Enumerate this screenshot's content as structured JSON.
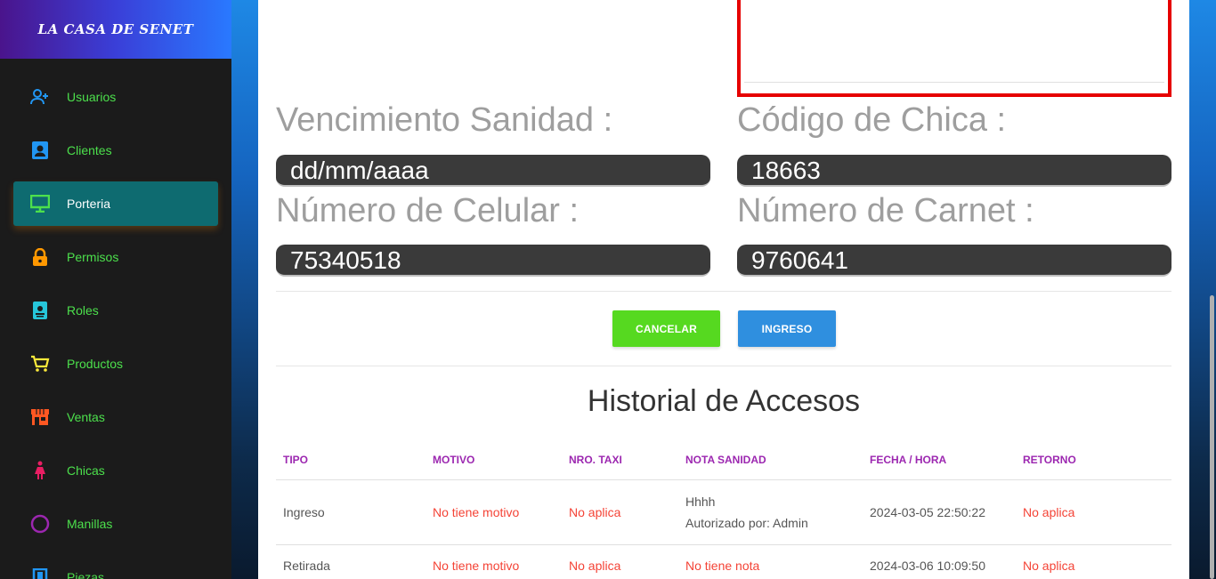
{
  "brand": "LA CASA DE SENET",
  "sidebar": {
    "items": [
      {
        "label": "Usuarios",
        "icon": "user-plus-icon",
        "color": "#2196f3"
      },
      {
        "label": "Clientes",
        "icon": "contact-card-icon",
        "color": "#2196f3"
      },
      {
        "label": "Porteria",
        "icon": "monitor-icon",
        "color": "#4ce04c",
        "active": true
      },
      {
        "label": "Permisos",
        "icon": "lock-icon",
        "color": "#ff9800"
      },
      {
        "label": "Roles",
        "icon": "badge-icon",
        "color": "#26c6da"
      },
      {
        "label": "Productos",
        "icon": "cart-icon",
        "color": "#ffeb3b"
      },
      {
        "label": "Ventas",
        "icon": "store-icon",
        "color": "#ff5722"
      },
      {
        "label": "Chicas",
        "icon": "woman-icon",
        "color": "#e91e63"
      },
      {
        "label": "Manillas",
        "icon": "circle-icon",
        "color": "#9c27b0"
      },
      {
        "label": "Piezas",
        "icon": "door-icon",
        "color": "#2196f3"
      }
    ]
  },
  "form": {
    "vencimiento_label": "Vencimiento Sanidad :",
    "vencimiento_value": "dd/mm/aaaa",
    "codigo_label": "Código de Chica :",
    "codigo_value": "18663",
    "celular_label": "Número de Celular :",
    "celular_value": "75340518",
    "carnet_label": "Número de Carnet :",
    "carnet_value": "9760641"
  },
  "buttons": {
    "cancel": "CANCELAR",
    "ingreso": "INGRESO"
  },
  "historial": {
    "title": "Historial de Accesos",
    "columns": [
      "TIPO",
      "MOTIVO",
      "NRO. TAXI",
      "NOTA SANIDAD",
      "FECHA / HORA",
      "RETORNO"
    ],
    "rows": [
      {
        "tipo": "Ingreso",
        "motivo": "No tiene motivo",
        "taxi": "No aplica",
        "nota": "Hhhh",
        "nota2": "Autorizado por: Admin",
        "fecha": "2024-03-05 22:50:22",
        "retorno": "No aplica"
      },
      {
        "tipo": "Retirada",
        "motivo": "No tiene motivo",
        "taxi": "No aplica",
        "nota": "No tiene nota",
        "nota2": "",
        "fecha": "2024-03-06 10:09:50",
        "retorno": "No aplica"
      }
    ]
  }
}
